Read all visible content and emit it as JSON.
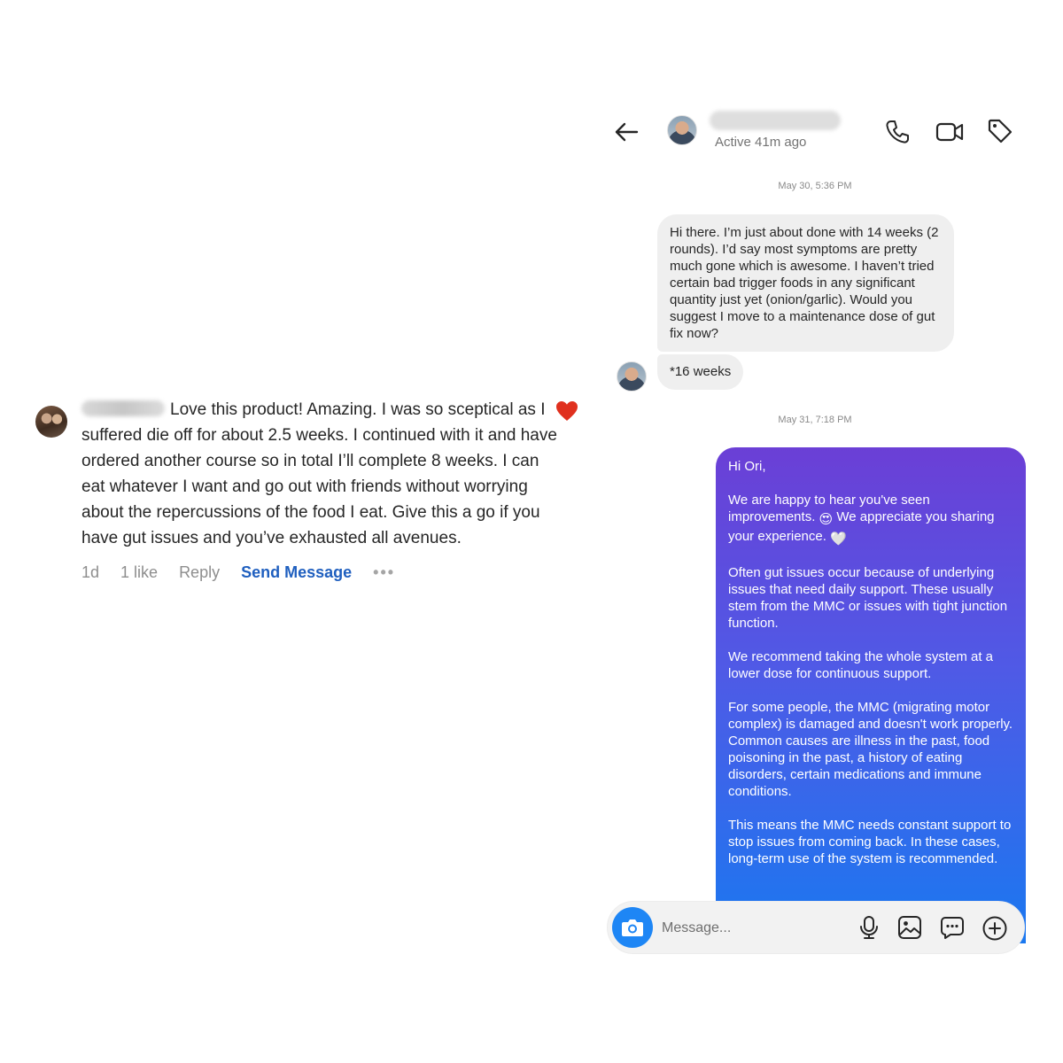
{
  "comment": {
    "text": "Love this product! Amazing. I was so sceptical as I suffered die off for about 2.5 weeks. I continued with it and have ordered another course so in total I’ll complete 8 weeks. I can eat whatever I want and go out with friends without worrying about the repercussions of the food I eat. Give this a go if you have gut issues and you’ve exhausted all avenues.",
    "time": "1d",
    "likes": "1 like",
    "reply_label": "Reply",
    "send_message_label": "Send Message",
    "more_label": "•••",
    "accent_color": "#1f5fbf",
    "heart_color": "#e0301e"
  },
  "dm": {
    "header": {
      "status": "Active 41m ago"
    },
    "timestamps": [
      "May 30, 5:36 PM",
      "May 31, 7:18 PM"
    ],
    "incoming": [
      "Hi there. I’m just about done with 14 weeks (2 rounds). I’d say most symptoms are pretty much gone which is awesome. I haven’t tried certain bad trigger foods in any significant quantity just yet (onion/garlic). Would you suggest I move to a maintenance dose of gut fix now?",
      "*16 weeks"
    ],
    "outgoing": {
      "greeting": "Hi Ori,",
      "p1_a": "We are happy to hear you've seen improvements.",
      "p1_emoji1": "😍",
      "p1_b": "We appreciate you sharing your experience.",
      "p1_emoji2": "🤍",
      "p2": "Often gut issues occur because of underlying issues that need daily support. These usually stem from the MMC or issues with tight junction function.",
      "p3": "We recommend taking the whole system at a lower dose for continuous support.",
      "p4": "For some people, the MMC (migrating motor complex) is damaged and doesn't work properly. Common causes are illness in the past, food poisoning in the past, a history of eating disorders, certain medications and immune conditions.",
      "p5": "This means the MMC needs constant support to stop issues from coming back. In these cases, long-term use of the system is recommended."
    },
    "composer": {
      "placeholder": "Message..."
    },
    "colors": {
      "bubble_gradient_top": "#6b3fd6",
      "bubble_gradient_bottom": "#1a78f0",
      "camera_button": "#1e86f5"
    }
  }
}
